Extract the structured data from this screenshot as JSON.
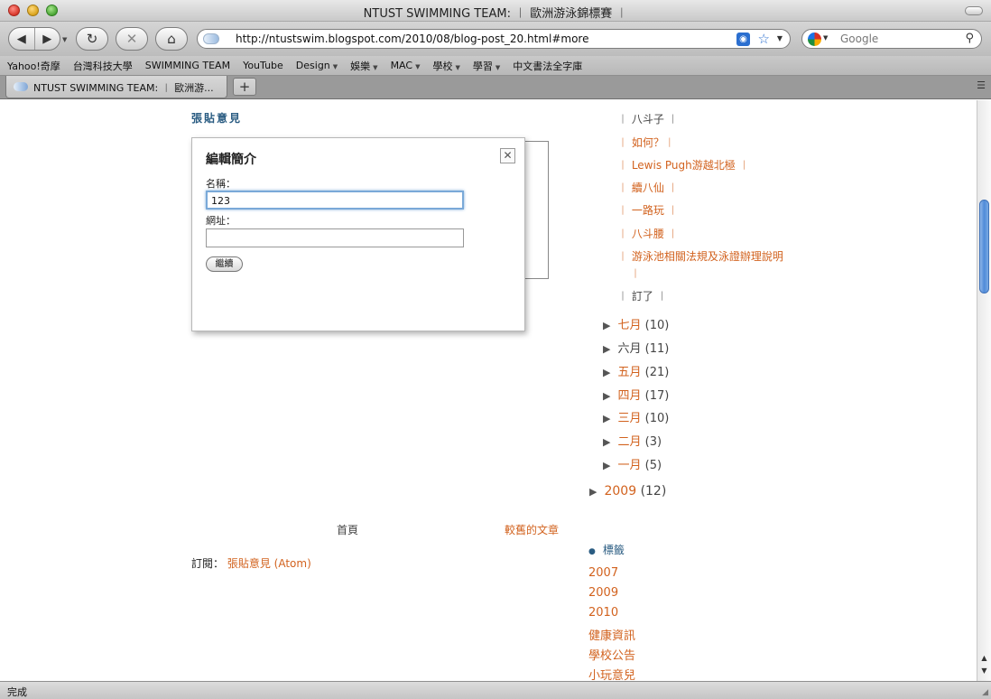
{
  "window": {
    "title": "NTUST SWIMMING TEAM: ︱ 歐洲游泳錦標賽 ︱",
    "status": "完成"
  },
  "toolbar": {
    "back_icon": "◀",
    "forward_icon": "▶",
    "reload_icon": "↻",
    "stop_icon": "✕",
    "home_icon": "⌂",
    "url": "http://ntustswim.blogspot.com/2010/08/blog-post_20.html#more",
    "search_placeholder": "Google"
  },
  "bookmarks": [
    {
      "label": "Yahoo!奇摩",
      "menu": false
    },
    {
      "label": "台灣科技大學",
      "menu": false
    },
    {
      "label": "SWIMMING TEAM",
      "menu": false
    },
    {
      "label": "YouTube",
      "menu": false
    },
    {
      "label": "Design",
      "menu": true
    },
    {
      "label": "娛樂",
      "menu": true
    },
    {
      "label": "MAC",
      "menu": true
    },
    {
      "label": "學校",
      "menu": true
    },
    {
      "label": "學習",
      "menu": true
    },
    {
      "label": "中文書法全字庫",
      "menu": false
    }
  ],
  "tabs": {
    "active_label": "NTUST SWIMMING TEAM: ︱ 歐洲游...",
    "new_tab": "+"
  },
  "content": {
    "post_comment": "張貼意見",
    "dialog": {
      "title": "編輯簡介",
      "close": "✕",
      "name_label": "名稱：",
      "name_value": "123",
      "url_label": "網址：",
      "url_value": "",
      "continue_button": "繼續"
    },
    "recent_posts": [
      {
        "text": "︱ 八斗子 ︱",
        "linked": false
      },
      {
        "text": "︱ 如何？︱",
        "linked": true
      },
      {
        "text": "︱ Lewis Pugh游越北極 ︱",
        "linked": true
      },
      {
        "text": "︱ 續八仙 ︱",
        "linked": true
      },
      {
        "text": "︱ 一路玩 ︱",
        "linked": true
      },
      {
        "text": "︱ 八斗腰 ︱",
        "linked": true
      },
      {
        "text": "︱ 游泳池相關法規及泳證辦理說明",
        "linked": true
      },
      {
        "text": "︱",
        "linked": true
      },
      {
        "text": "︱ 訂了 ︱",
        "linked": false
      }
    ],
    "archive_months": [
      {
        "name": "七月",
        "count": "(10)",
        "linked": true
      },
      {
        "name": "六月",
        "count": "(11)",
        "linked": false
      },
      {
        "name": "五月",
        "count": "(21)",
        "linked": true
      },
      {
        "name": "四月",
        "count": "(17)",
        "linked": true
      },
      {
        "name": "三月",
        "count": "(10)",
        "linked": true
      },
      {
        "name": "二月",
        "count": "(3)",
        "linked": true
      },
      {
        "name": "一月",
        "count": "(5)",
        "linked": true
      }
    ],
    "archive_year": {
      "name": "2009",
      "count": "(12)"
    },
    "home_link": "首頁",
    "older_link": "較舊的文章",
    "subscribe_label": "訂閱：",
    "subscribe_link": "張貼意見 (Atom)",
    "labels_heading": "標籤",
    "labels": [
      "2007",
      "2009",
      "2010",
      "健康資訊",
      "學校公告",
      "小玩意兒"
    ]
  },
  "colors": {
    "link": "#d2621e",
    "heading": "#2a5c82",
    "scroll_thumb": "#4f8ad9"
  }
}
